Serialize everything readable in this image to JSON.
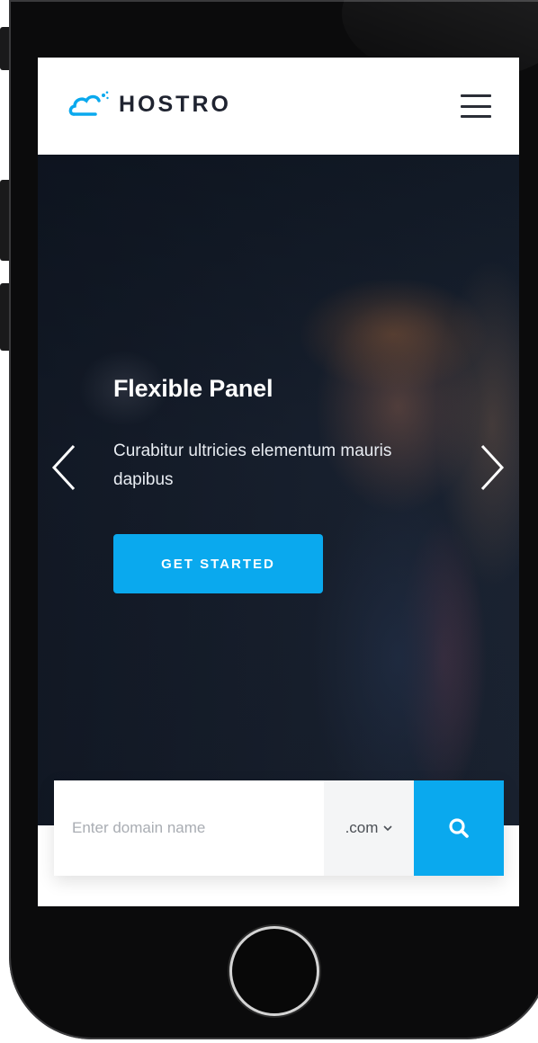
{
  "brand": {
    "name": "HOSTRO"
  },
  "nav": {
    "menu_icon": "hamburger-menu-icon"
  },
  "hero": {
    "title": "Flexible Panel",
    "subtitle": "Curabitur ultricies elementum mauris dapibus",
    "cta_label": "GET STARTED",
    "prev_icon": "chevron-left-icon",
    "next_icon": "chevron-right-icon"
  },
  "domain_search": {
    "placeholder": "Enter domain name",
    "tld_selected": ".com",
    "search_icon": "search-icon"
  },
  "colors": {
    "accent": "#0aa9ee",
    "brand_text": "#1f2330",
    "hero_overlay": "#151c28"
  }
}
